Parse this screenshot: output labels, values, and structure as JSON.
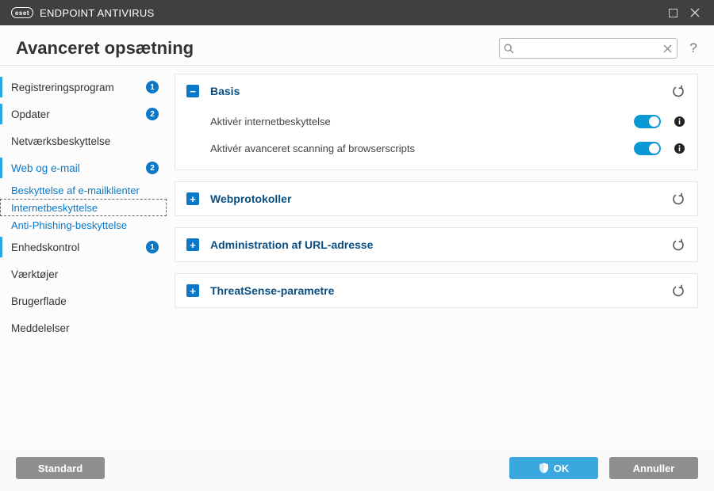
{
  "brand_short": "eset",
  "product_name": "ENDPOINT ANTIVIRUS",
  "page_title": "Avanceret opsætning",
  "search": {
    "placeholder": ""
  },
  "sidebar": {
    "items": [
      {
        "label": "Registreringsprogram",
        "badge": "1"
      },
      {
        "label": "Opdater",
        "badge": "2"
      },
      {
        "label": "Netværksbeskyttelse"
      },
      {
        "label": "Web og e-mail",
        "badge": "2"
      },
      {
        "label": "Enhedskontrol",
        "badge": "1"
      },
      {
        "label": "Værktøjer"
      },
      {
        "label": "Brugerflade"
      },
      {
        "label": "Meddelelser"
      }
    ],
    "web_children": [
      {
        "label": "Beskyttelse af e-mailklienter"
      },
      {
        "label": "Internetbeskyttelse"
      },
      {
        "label": "Anti-Phishing-beskyttelse"
      }
    ]
  },
  "sections": {
    "basis": {
      "title": "Basis",
      "rows": [
        {
          "label": "Aktivér internetbeskyttelse"
        },
        {
          "label": "Aktivér avanceret scanning af browserscripts"
        }
      ]
    },
    "web": {
      "title": "Webprotokoller"
    },
    "url": {
      "title": "Administration af URL-adresse"
    },
    "threat": {
      "title": "ThreatSense-parametre"
    }
  },
  "footer": {
    "default": "Standard",
    "ok": "OK",
    "cancel": "Annuller"
  }
}
